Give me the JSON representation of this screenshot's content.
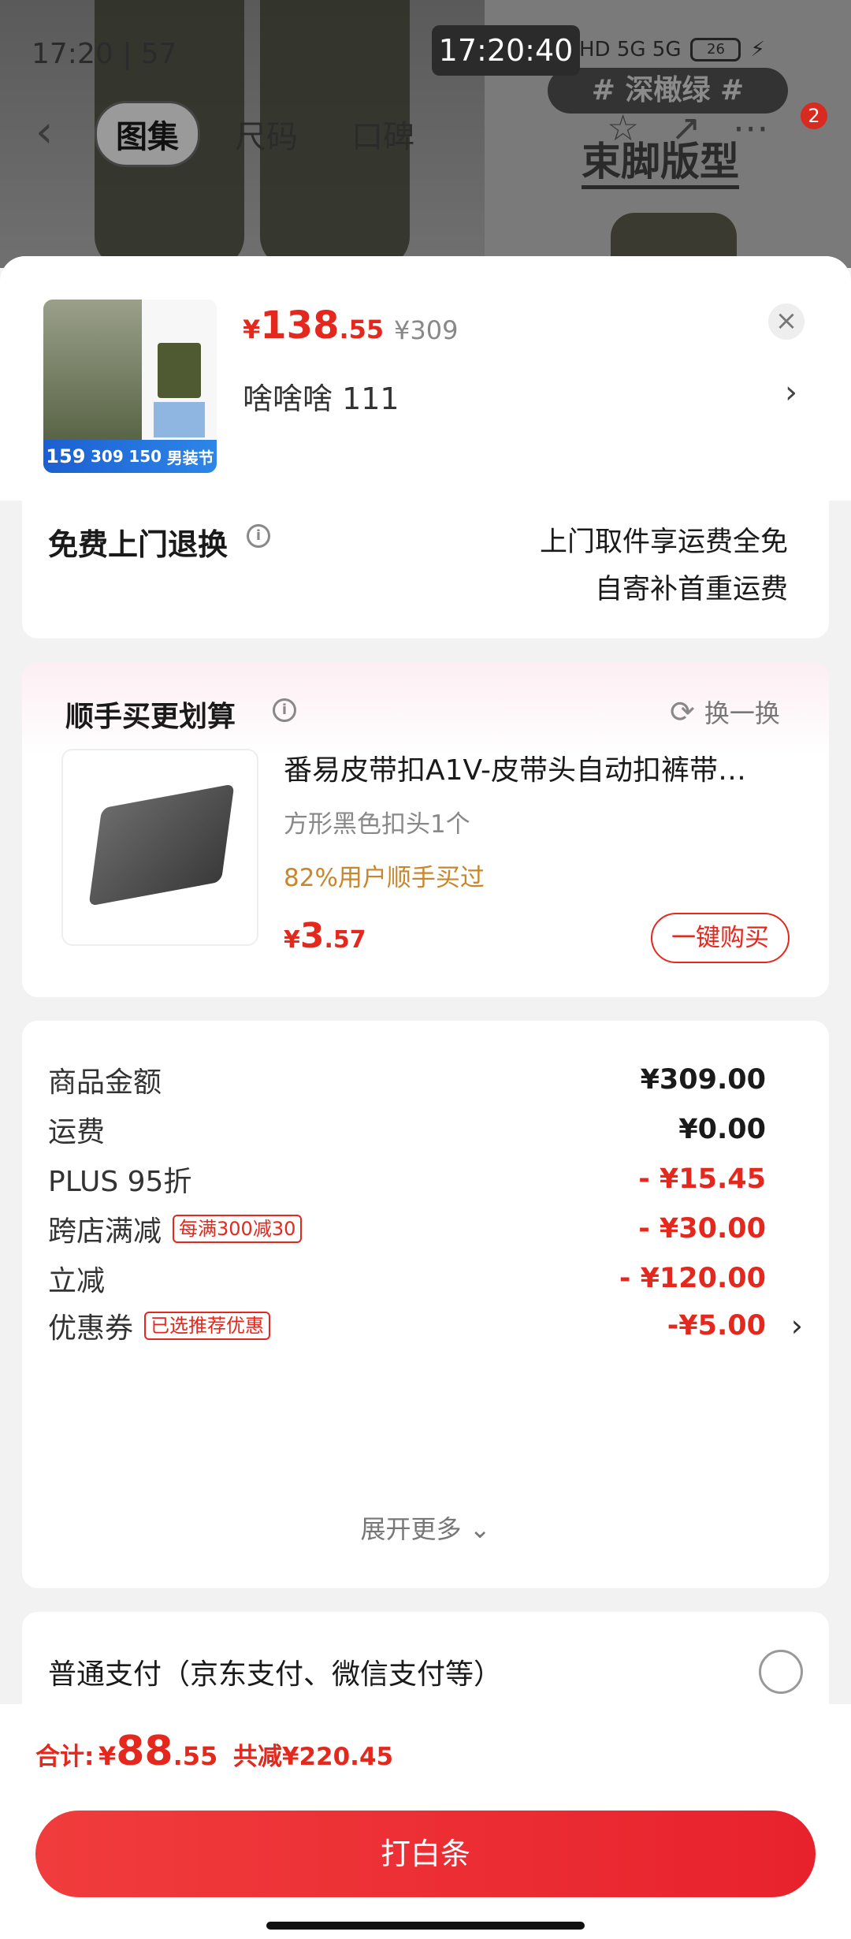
{
  "status_bar": {
    "left_text": "17:20 | 57",
    "time": "17:20:40",
    "network": "HD 5G 5G",
    "battery": "26"
  },
  "background_page": {
    "tag": "# 深橄绿 #",
    "heading": "束脚版型",
    "nav_tabs": [
      "图集",
      "尺码",
      "口碑"
    ],
    "badge_count": "2"
  },
  "product": {
    "price_currency": "¥",
    "price_int": "138",
    "price_dec": ".55",
    "original_price": "¥309",
    "variant": "啥啥啥  111",
    "thumb_price": "159",
    "thumb_mid": "309",
    "thumb_right": "150",
    "thumb_tag": "男装节"
  },
  "returns": {
    "title": "免费上门退换",
    "line1": "上门取件享运费全免",
    "line2": "自寄补首重运费"
  },
  "recommend": {
    "title": "顺手买更划算",
    "swap_label": "换一换",
    "name": "番易皮带扣A1V-皮带头自动扣裤带…",
    "spec": "方形黑色扣头1个",
    "buy_rate": "82%用户顺手买过",
    "price_currency": "¥",
    "price_int": "3",
    "price_dec": ".57",
    "buy_button": "一键购买"
  },
  "price_rows": [
    {
      "label": "商品金额",
      "value": "¥309.00",
      "red": false
    },
    {
      "label": "运费",
      "value": "¥0.00",
      "red": false
    },
    {
      "label": "PLUS 95折",
      "value": "- ¥15.45",
      "red": true
    },
    {
      "label": "跨店满减",
      "tag": "每满300减30",
      "value": "- ¥30.00",
      "red": true
    },
    {
      "label": "立减",
      "value": "- ¥120.00",
      "red": true
    },
    {
      "label": "优惠券",
      "tag": "已选推荐优惠",
      "value": "-¥5.00",
      "red": true
    }
  ],
  "expand_more": "展开更多",
  "payment": {
    "label": "普通支付（京东支付、微信支付等）"
  },
  "footer": {
    "total_label": "合计:",
    "total_currency": "¥",
    "total_int": "88",
    "total_dec": ".55",
    "saved": "共减¥220.45",
    "pay_button": "打白条"
  },
  "colors": {
    "accent_red": "#e4281e",
    "orange_text": "#c9862a",
    "button_gradient_start": "#f03c3c"
  }
}
